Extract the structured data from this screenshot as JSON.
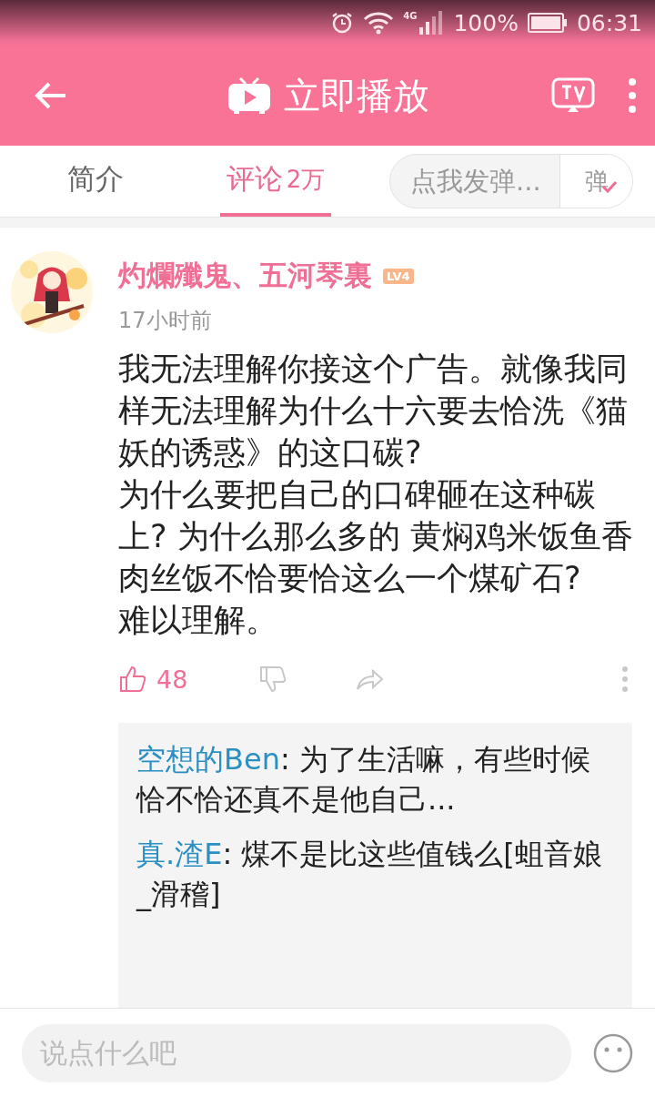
{
  "status_bar": {
    "network": "4G",
    "battery": "100%",
    "time": "06:31"
  },
  "header": {
    "title": "立即播放"
  },
  "tabs": [
    {
      "label": "简介",
      "selected": false
    },
    {
      "label": "评论",
      "count": "2万",
      "selected": true
    }
  ],
  "danmaku": {
    "placeholder": "点我发弹...",
    "button": "弹"
  },
  "comment": {
    "author": "灼爛殲鬼、五河琴裏",
    "level": "LV4",
    "time": "17小时前",
    "text": "我无法理解你接这个广告。就像我同样无法理解为什么十六要去恰洗《猫妖的诱惑》的这口碳?\n为什么要把自己的口碑砸在这种碳上? 为什么那么多的 黄焖鸡米饭鱼香肉丝饭不恰要恰这么一个煤矿石?\n难以理解。",
    "likes": "48",
    "replies": [
      {
        "author": "空想的Ben",
        "text": ": 为了生活嘛，有些时候恰不恰还真不是他自己..."
      },
      {
        "author": "真.渣E",
        "text": ": 煤不是比这些值钱么[蛆音娘_滑稽]"
      }
    ]
  },
  "input": {
    "placeholder": "说点什么吧"
  }
}
